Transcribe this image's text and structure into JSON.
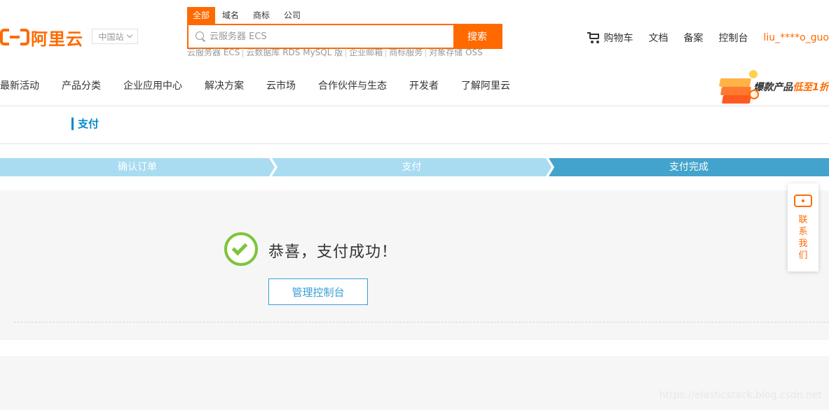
{
  "header": {
    "logo_text": "阿里云",
    "region": "中国站",
    "search": {
      "tabs": [
        "全部",
        "域名",
        "商标",
        "公司"
      ],
      "active_tab": "全部",
      "placeholder": "云服务器 ECS",
      "button_label": "搜索",
      "hot_words": [
        "云服务器 ECS",
        "云数据库 RDS MySQL 版",
        "企业邮箱",
        "商标服务",
        "对象存储 OSS"
      ]
    },
    "top_links": {
      "cart": "购物车",
      "docs": "文档",
      "filing": "备案",
      "console": "控制台",
      "user": "liu_****o_guo"
    },
    "nav": [
      "最新活动",
      "产品分类",
      "企业应用中心",
      "解决方案",
      "云市场",
      "合作伙伴与生态",
      "开发者",
      "了解阿里云"
    ],
    "promo": {
      "text": "爆款产品",
      "highlight": "低至1折"
    }
  },
  "page_title": "支付",
  "steps": [
    {
      "label": "确认订单",
      "state": "done"
    },
    {
      "label": "支付",
      "state": "done"
    },
    {
      "label": "支付完成",
      "state": "current"
    }
  ],
  "success": {
    "message": "恭喜，支付成功！",
    "button_label": "管理控制台"
  },
  "contact": {
    "label": "联系我们"
  },
  "colors": {
    "brand": "#ff6a00",
    "step_done": "#a9dcf1",
    "step_current": "#44a3cc",
    "success": "#7cc53a",
    "link_blue": "#3a9ed4"
  },
  "watermark": "https://elasticstack.blog.csdn.net"
}
